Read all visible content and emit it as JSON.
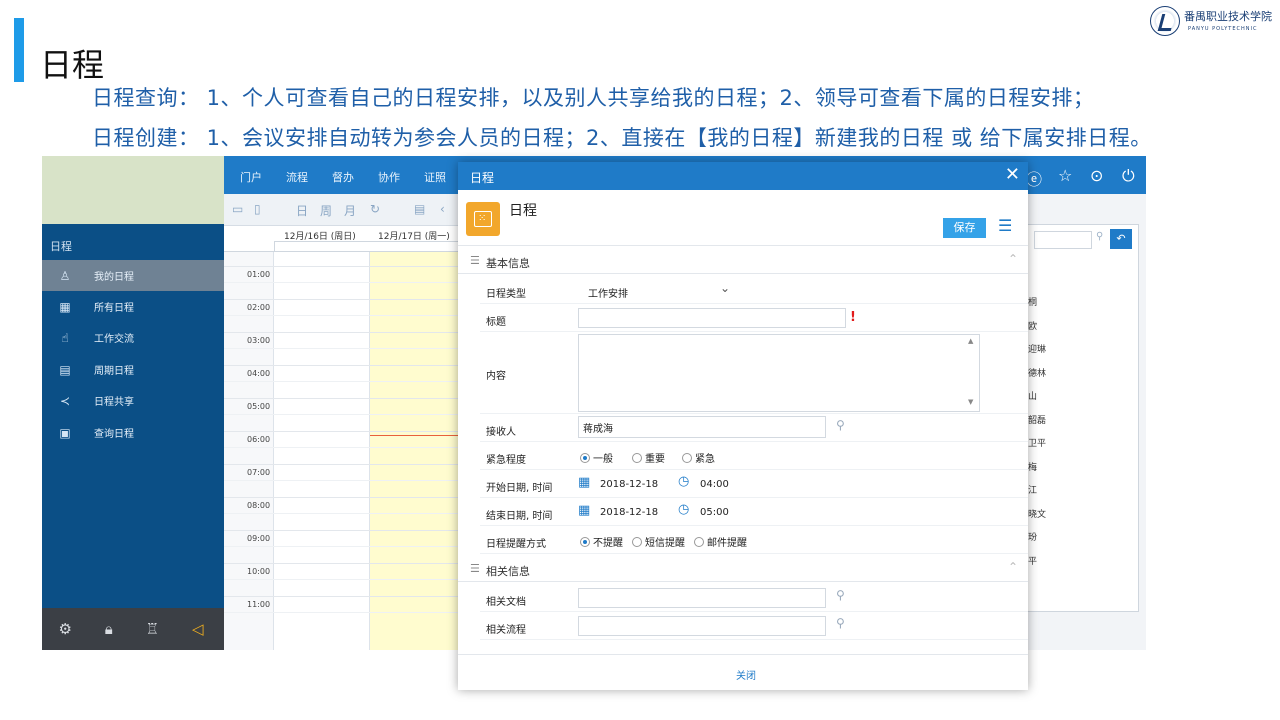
{
  "slide": {
    "title": "日程",
    "line1": "日程查询：  1、个人可查看自己的日程安排，以及别人共享给我的日程；2、领导可查看下属的日程安排；",
    "line2": "日程创建：  1、会议安排自动转为参会人员的日程；2、直接在【我的日程】新建我的日程 或 给下属安排日程。",
    "logo_text": "番禺职业技术学院",
    "logo_en": "PANYU POLYTECHNIC"
  },
  "sidebar": {
    "heading": "日程",
    "items": [
      {
        "label": "我的日程",
        "icon": "user-icon"
      },
      {
        "label": "所有日程",
        "icon": "calendar-icon"
      },
      {
        "label": "工作交流",
        "icon": "hand-icon"
      },
      {
        "label": "周期日程",
        "icon": "calendar-cycle-icon"
      },
      {
        "label": "日程共享",
        "icon": "share-icon"
      },
      {
        "label": "查询日程",
        "icon": "calendar-search-icon"
      }
    ],
    "bottom_icons": [
      "settings-icon",
      "lock-icon",
      "shirt-icon",
      "speaker-icon"
    ]
  },
  "topnav": {
    "items": [
      "门户",
      "流程",
      "督办",
      "协作",
      "证照"
    ],
    "right_icons": [
      "ie-icon",
      "star-icon",
      "more-icon",
      "power-icon"
    ]
  },
  "calendar": {
    "toolbar": [
      "日",
      "周",
      "月"
    ],
    "days": [
      "12月/16日 (周日)",
      "12月/17日 (周一)"
    ],
    "hours": [
      "01:00",
      "02:00",
      "03:00",
      "04:00",
      "05:00",
      "06:00",
      "07:00",
      "08:00",
      "09:00",
      "10:00",
      "11:00"
    ]
  },
  "rightpanel": {
    "names": [
      "桐",
      "欧",
      "迎琳",
      "德林",
      "山",
      "韶磊",
      "卫平",
      "梅",
      "江",
      "晓文",
      "玢",
      "平"
    ]
  },
  "modal": {
    "title": "日程",
    "header_name": "日程",
    "save_label": "保存",
    "close_label": "关闭",
    "section_basic": "基本信息",
    "section_related": "相关信息",
    "fields": {
      "type_label": "日程类型",
      "type_value": "工作安排",
      "title_label": "标题",
      "title_value": "",
      "content_label": "内容",
      "content_value": "",
      "receiver_label": "接收人",
      "receiver_value": "蒋成海",
      "urgency_label": "紧急程度",
      "urgency_options": [
        "一般",
        "重要",
        "紧急"
      ],
      "urgency_selected": "一般",
      "start_label": "开始日期, 时间",
      "start_date": "2018-12-18",
      "start_time": "04:00",
      "end_label": "结束日期, 时间",
      "end_date": "2018-12-18",
      "end_time": "05:00",
      "remind_label": "日程提醒方式",
      "remind_options": [
        "不提醒",
        "短信提醒",
        "邮件提醒"
      ],
      "remind_selected": "不提醒",
      "doc_label": "相关文档",
      "flow_label": "相关流程"
    }
  }
}
